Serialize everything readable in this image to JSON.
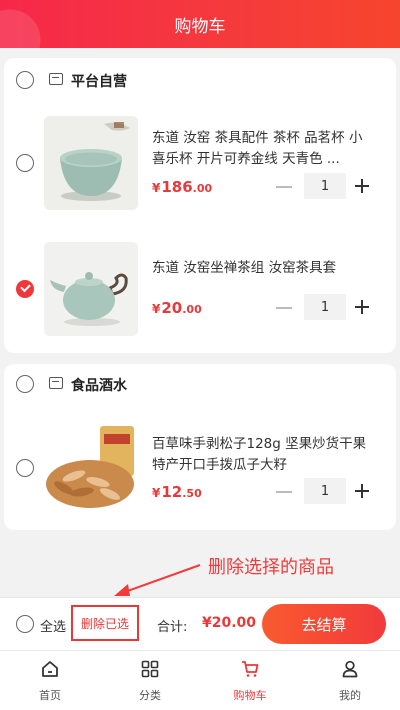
{
  "header": {
    "title": "购物车"
  },
  "shops": [
    {
      "name": "平台自营",
      "items": [
        {
          "title": "东道 汝窑 茶具配件 茶杯 品茗杯 小喜乐杯 开片可养金线 天青色 ...",
          "currency": "¥",
          "price_int": "186",
          "price_dec": ".00",
          "qty": "1",
          "checked": false
        },
        {
          "title": "东道 汝窑坐禅茶组 汝窑茶具套",
          "currency": "¥",
          "price_int": "20",
          "price_dec": ".00",
          "qty": "1",
          "checked": true
        }
      ]
    },
    {
      "name": "食品酒水",
      "items": [
        {
          "title": "百草味手剥松子128g 坚果炒货干果特产开口手拨瓜子大籽",
          "currency": "¥",
          "price_int": "12",
          "price_dec": ".50",
          "qty": "1",
          "checked": false
        }
      ]
    }
  ],
  "annotation": "删除选择的商品",
  "footer": {
    "select_all": "全选",
    "delete_selected": "删除已选",
    "total_label": "合计:",
    "total_value": "¥20.00",
    "checkout": "去结算"
  },
  "tabs": [
    {
      "label": "首页",
      "icon": "home-icon"
    },
    {
      "label": "分类",
      "icon": "category-icon"
    },
    {
      "label": "购物车",
      "icon": "cart-icon",
      "active": true
    },
    {
      "label": "我的",
      "icon": "user-icon"
    }
  ],
  "colors": {
    "accent": "#e9383a",
    "header_start": "#f6284a",
    "header_end": "#f6452e"
  }
}
